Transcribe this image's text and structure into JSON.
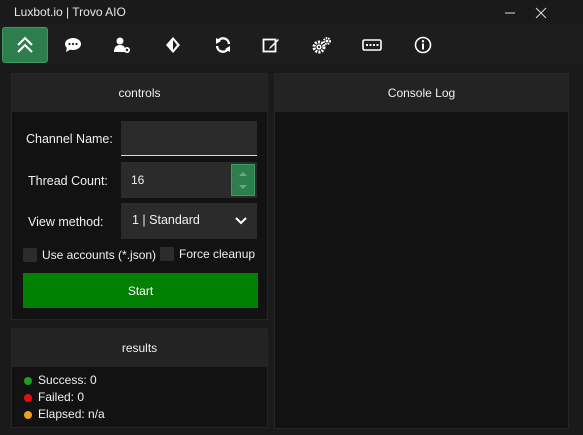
{
  "window": {
    "title": "Luxbot.io | Trovo AIO"
  },
  "toolbar": {
    "items": [
      {
        "icon": "double-chevron-up-icon",
        "active": true
      },
      {
        "icon": "chat-bubble-icon"
      },
      {
        "icon": "user-gear-icon"
      },
      {
        "icon": "diamond-icon"
      },
      {
        "icon": "refresh-icon"
      },
      {
        "icon": "edit-icon"
      },
      {
        "icon": "gears-icon"
      },
      {
        "icon": "keyboard-icon"
      },
      {
        "icon": "info-icon"
      }
    ]
  },
  "controls": {
    "header": "controls",
    "channel_label": "Channel Name:",
    "channel_value": "",
    "thread_label": "Thread Count:",
    "thread_value": "16",
    "view_label": "View method:",
    "view_value": "1 | Standard",
    "use_accounts_label": "Use accounts (*.json)",
    "force_cleanup_label": "Force cleanup",
    "start_label": "Start"
  },
  "results": {
    "header": "results",
    "success": "Success: 0",
    "failed": "Failed: 0",
    "elapsed": "Elapsed: n/a"
  },
  "console": {
    "header": "Console Log"
  },
  "colors": {
    "accent": "#2e7d4c",
    "start": "#018001",
    "success": "#1f9d1f",
    "failed": "#e01010",
    "elapsed": "#f0a020"
  }
}
